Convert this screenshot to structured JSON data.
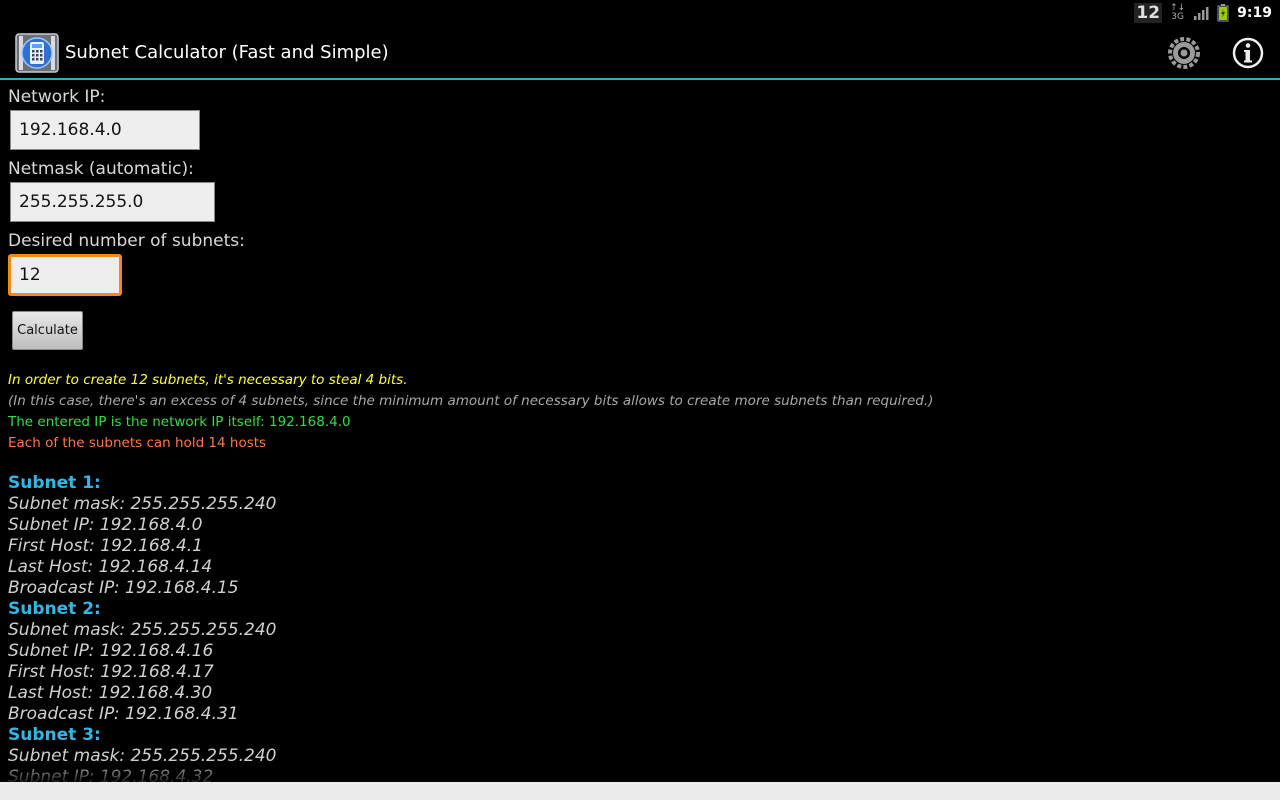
{
  "status_bar": {
    "notification_count": "12",
    "network_type": "3G",
    "time": "9:19"
  },
  "action_bar": {
    "title": "Subnet Calculator (Fast and Simple)",
    "app_icon": "calculator-icon",
    "settings_icon": "settings-icon",
    "info_icon": "info-icon"
  },
  "form": {
    "network_ip_label": "Network IP:",
    "network_ip_value": "192.168.4.0",
    "netmask_label": "Netmask (automatic):",
    "netmask_value": "255.255.255.0",
    "subnets_label": "Desired number of subnets:",
    "subnets_value": "12",
    "calculate_label": "Calculate"
  },
  "results": {
    "steal_bits": "In order to create 12 subnets, it's necessary to steal 4 bits.",
    "excess": "(In this case, there's an excess of 4 subnets, since the minimum amount of necessary bits allows to create more subnets than required.)",
    "network_ip_note": "The entered IP is the network IP itself: 192.168.4.0",
    "hosts_note": "Each of the subnets can hold 14 hosts"
  },
  "subnets": [
    {
      "title": "Subnet 1:",
      "mask": "Subnet mask: 255.255.255.240",
      "ip": "Subnet IP: 192.168.4.0",
      "first": "First Host: 192.168.4.1",
      "last": "Last Host: 192.168.4.14",
      "broadcast": "Broadcast IP: 192.168.4.15"
    },
    {
      "title": "Subnet 2:",
      "mask": "Subnet mask: 255.255.255.240",
      "ip": "Subnet IP: 192.168.4.16",
      "first": "First Host: 192.168.4.17",
      "last": "Last Host: 192.168.4.30",
      "broadcast": "Broadcast IP: 192.168.4.31"
    },
    {
      "title": "Subnet 3:",
      "mask": "Subnet mask: 255.255.255.240",
      "ip": "Subnet IP: 192.168.4.32"
    }
  ],
  "colors": {
    "accent": "#33b5e5",
    "focus": "#f08a1c",
    "yellow": "#ffff33",
    "green": "#33dd44",
    "orange": "#ff7744"
  }
}
